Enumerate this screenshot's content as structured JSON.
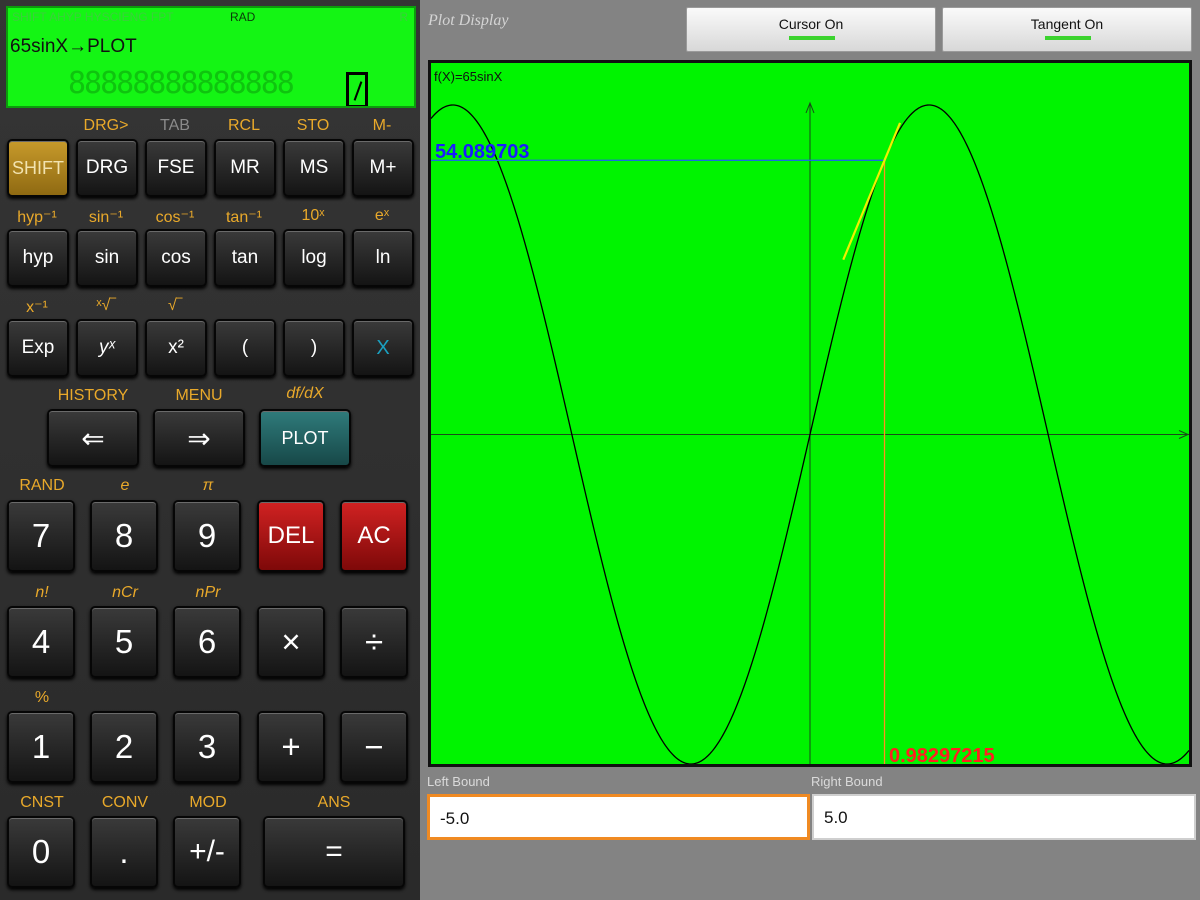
{
  "display": {
    "status_text": "SHIFT AHYP HYSCIENG FPT",
    "angle_mode": "RAD",
    "status_mark": "R",
    "expression": "65sinX→PLOT",
    "result_ghost": "88888888888888"
  },
  "rows": {
    "row1": {
      "labels": [
        "",
        "DRG>",
        "TAB",
        "RCL",
        "STO",
        "M-"
      ],
      "keys": [
        "SHIFT",
        "DRG",
        "FSE",
        "MR",
        "MS",
        "M+"
      ]
    },
    "row2": {
      "labels": [
        "hyp⁻¹",
        "sin⁻¹",
        "cos⁻¹",
        "tan⁻¹",
        "10ˣ",
        "eˣ"
      ],
      "keys": [
        "hyp",
        "sin",
        "cos",
        "tan",
        "log",
        "ln"
      ]
    },
    "row3": {
      "labels": [
        "x⁻¹",
        "ˣ√‾",
        "√‾",
        "",
        "",
        ""
      ],
      "keys": [
        "Exp",
        "yˣ",
        "x²",
        "(",
        ")",
        "X"
      ]
    },
    "row4": {
      "labels": [
        "HISTORY",
        "MENU",
        "df/dX"
      ],
      "keys": [
        "⇐",
        "⇒",
        "PLOT"
      ]
    },
    "row5": {
      "labels": [
        "RAND",
        "e",
        "π",
        "",
        ""
      ],
      "keys": [
        "7",
        "8",
        "9",
        "DEL",
        "AC"
      ]
    },
    "row6": {
      "labels": [
        "n!",
        "nCr",
        "nPr",
        "",
        ""
      ],
      "keys": [
        "4",
        "5",
        "6",
        "×",
        "÷"
      ]
    },
    "row7": {
      "labels": [
        "%",
        "",
        "",
        "",
        ""
      ],
      "keys": [
        "1",
        "2",
        "3",
        "+",
        "−"
      ]
    },
    "row8": {
      "labels": [
        "CNST",
        "CONV",
        "MOD",
        "ANS"
      ],
      "keys": [
        "0",
        ".",
        "+/-",
        "="
      ]
    }
  },
  "plot": {
    "title": "Plot Display",
    "cursor_button": "Cursor On",
    "tangent_button": "Tangent On",
    "function_label": "f(X)=65sinX",
    "y_readout": "54.089703",
    "x_readout": "0.98297215",
    "left_bound_label": "Left Bound",
    "right_bound_label": "Right Bound",
    "left_bound_value": "-5.0",
    "right_bound_value": "5.0",
    "colors": {
      "background": "#00f400",
      "curve": "#000000",
      "tangent": "#f0f000",
      "cursor_horizontal": "#1a6be0",
      "cursor_vertical": "#ff9020"
    }
  },
  "chart_data": {
    "type": "line",
    "function": "65sinX",
    "x_range": [
      -5.0,
      5.0
    ],
    "y_range": [
      -65,
      65
    ],
    "cursor": {
      "x": 0.98297215,
      "y": 54.089703
    },
    "tangent_slope": 36.04
  }
}
